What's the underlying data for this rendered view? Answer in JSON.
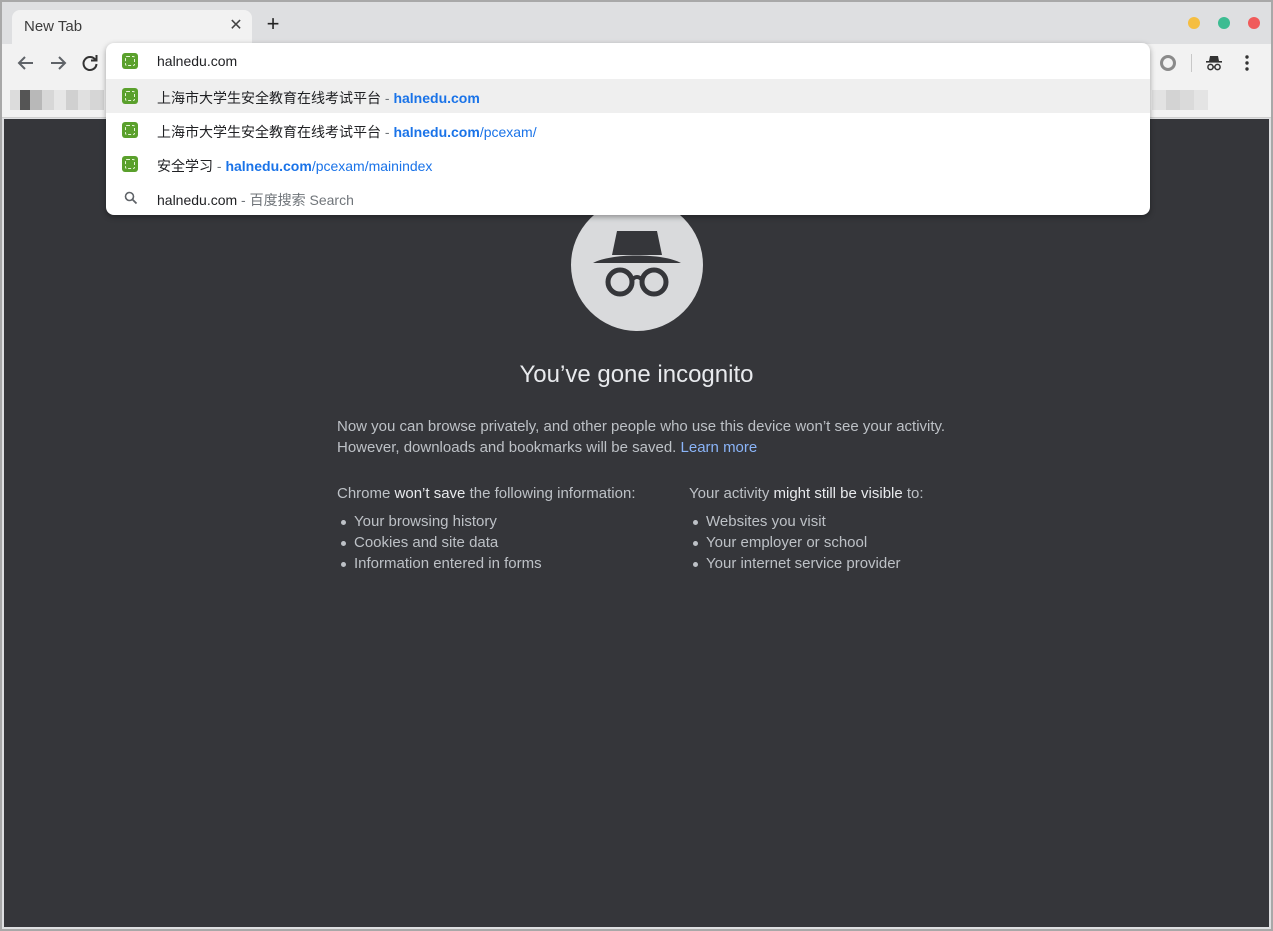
{
  "window": {
    "tab": {
      "title": "New Tab",
      "close_glyph": "✕"
    },
    "new_tab_glyph": "+",
    "traffic_lights": {
      "minimize": "#f5be41",
      "maximize": "#3dbc92",
      "close": "#f05b5b"
    }
  },
  "toolbar": {
    "icons": [
      "arrow-left-icon",
      "arrow-right-icon",
      "reload-icon",
      "extension-icon",
      "incognito-icon",
      "more-vert-icon"
    ]
  },
  "omnibox": {
    "value": "halnedu.com",
    "suggestions": [
      {
        "title": "上海市大学生安全教育在线考试平台",
        "sep": " - ",
        "url_bold": "halnedu.com",
        "url_rest": "",
        "icon": "site-favicon-icon"
      },
      {
        "title": "上海市大学生安全教育在线考试平台",
        "sep": " - ",
        "url_bold": "halnedu.com",
        "url_rest": "/pcexam/",
        "icon": "site-favicon-icon"
      },
      {
        "title": "安全学习",
        "sep": " - ",
        "url_bold": "halnedu.com",
        "url_rest": "/pcexam/mainindex",
        "icon": "site-favicon-icon"
      },
      {
        "title": "halnedu.com",
        "sep": " - ",
        "sub": "百度搜索 Search",
        "icon": "search-icon"
      }
    ]
  },
  "page": {
    "heading": "You’ve gone incognito",
    "intro": "Now you can browse privately, and other people who use this device won’t see your activity. However, downloads and bookmarks will be saved.",
    "learn_more": "Learn more",
    "left": {
      "pre": "Chrome ",
      "bold": "won’t save",
      "post": " the following information:",
      "items": [
        "Your browsing history",
        "Cookies and site data",
        "Information entered in forms"
      ]
    },
    "right": {
      "pre": "Your activity ",
      "bold": "might still be visible",
      "post": " to:",
      "items": [
        "Websites you visit",
        "Your employer or school",
        "Your internet service provider"
      ]
    }
  },
  "colors": {
    "page_bg": "#35363a",
    "link": "#8ab4f8",
    "url_blue": "#1a73e8"
  }
}
